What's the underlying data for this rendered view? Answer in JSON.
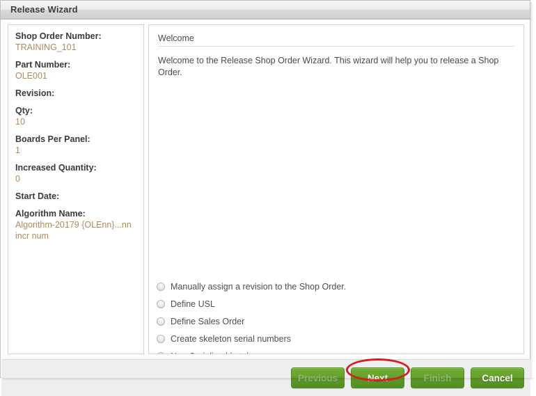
{
  "window": {
    "title": "Release Wizard"
  },
  "left_panel": {
    "fields": [
      {
        "label": "Shop Order Number:",
        "value": "TRAINING_101"
      },
      {
        "label": "Part Number:",
        "value": "OLE001"
      },
      {
        "label": "Revision:",
        "value": ""
      },
      {
        "label": "Qty:",
        "value": "10"
      },
      {
        "label": "Boards Per Panel:",
        "value": "1"
      },
      {
        "label": "Increased Quantity:",
        "value": "0"
      },
      {
        "label": "Start Date:",
        "value": ""
      },
      {
        "label": "Algorithm Name:",
        "value": "Algorithm-20179 {OLEnn}...nn incr num"
      }
    ]
  },
  "right_panel": {
    "section_title": "Welcome",
    "intro_text": "Welcome to the Release Shop Order Wizard. This wizard will help you to release a Shop Order.",
    "options": [
      {
        "label": "Manually assign a revision to the Shop Order.",
        "selected": false
      },
      {
        "label": "Define USL",
        "selected": false
      },
      {
        "label": "Define Sales Order",
        "selected": false
      },
      {
        "label": "Create skeleton serial numbers",
        "selected": false
      },
      {
        "label": "Non-Serialized batch",
        "selected": false
      }
    ]
  },
  "footer": {
    "buttons": [
      {
        "label": "Previous",
        "enabled": false
      },
      {
        "label": "Next",
        "enabled": true
      },
      {
        "label": "Finish",
        "enabled": false
      },
      {
        "label": "Cancel",
        "enabled": true
      }
    ]
  },
  "annotation": {
    "shape": "ellipse",
    "color": "#d61f20",
    "target": "Next"
  },
  "colors": {
    "button_green": "#63a02b",
    "value_text": "#b08b5c",
    "label_text": "#3a3a3a",
    "annotation_red": "#d61f20",
    "footer_bg": "#eeeeee"
  }
}
